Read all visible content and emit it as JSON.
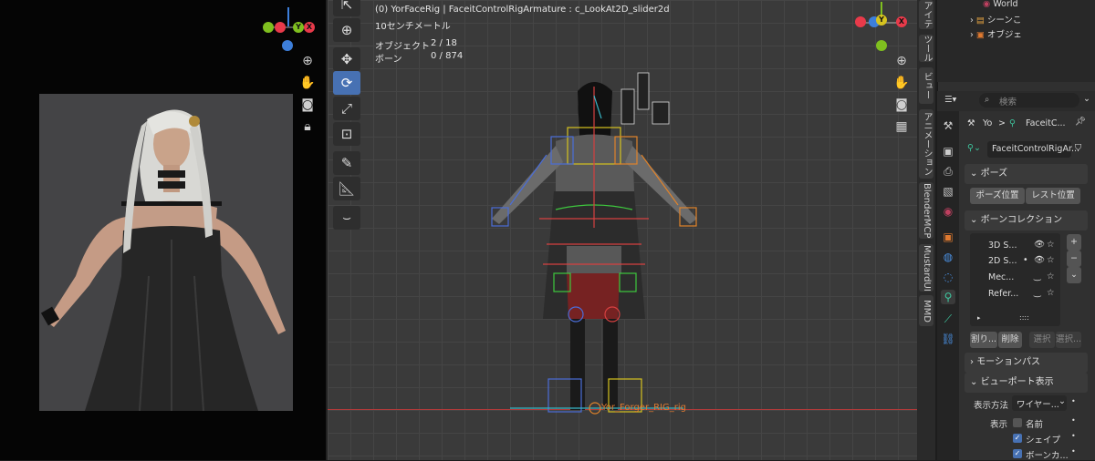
{
  "left_viewport": {
    "gizmo_labels": {
      "x": "X",
      "y": "Y",
      "z": "Z"
    }
  },
  "viewport": {
    "header_line": "(0) YorFaceRig | FaceitControlRigArmature : c_LookAt2D_slider2d",
    "scale_text": "10センチメートル",
    "objects_label": "オブジェクト",
    "objects_value": "2 / 18",
    "bones_label": "ボーン",
    "bones_value": "0 / 874",
    "rig_label": "Yor_Forger_RIG_rig",
    "gizmo_labels": {
      "x": "X",
      "y": "Y",
      "z": "Z"
    }
  },
  "side_tabs": [
    "アイテム",
    "ツール",
    "ビュー",
    "アニメーション",
    "BlenderMCP",
    "MustardUI",
    "MMD"
  ],
  "outliner": {
    "items": [
      "World",
      "シーンこ",
      "オブジェ"
    ]
  },
  "properties": {
    "search_placeholder": "検索",
    "breadcrumb_a": "Yo",
    "breadcrumb_sep": ">",
    "breadcrumb_b": "FaceitC...",
    "armature_name": "FaceitControlRigAr...",
    "pose_panel": {
      "title": "ポーズ",
      "pose_position": "ポーズ位置",
      "rest_position": "レスト位置"
    },
    "bone_collections": {
      "title": "ボーンコレクション",
      "items": [
        "3D S...",
        "2D S...",
        "Mec...",
        "Refer..."
      ],
      "assign": "割り...",
      "remove": "削除",
      "select": "選択",
      "deselect": "選択..."
    },
    "motion_paths": {
      "title": "モーションパス"
    },
    "viewport_display": {
      "title": "ビューポート表示",
      "display_as_label": "表示方法",
      "display_as_value": "ワイヤー...",
      "show_label": "表示",
      "names": "名前",
      "shapes": "シェイプ",
      "bone_colors": "ボーンカ..."
    }
  },
  "colors": {
    "accent": "#4771b3",
    "axis_x": "#e83a4a",
    "axis_y": "#7fbf1f",
    "axis_z": "#3d7fdb"
  }
}
